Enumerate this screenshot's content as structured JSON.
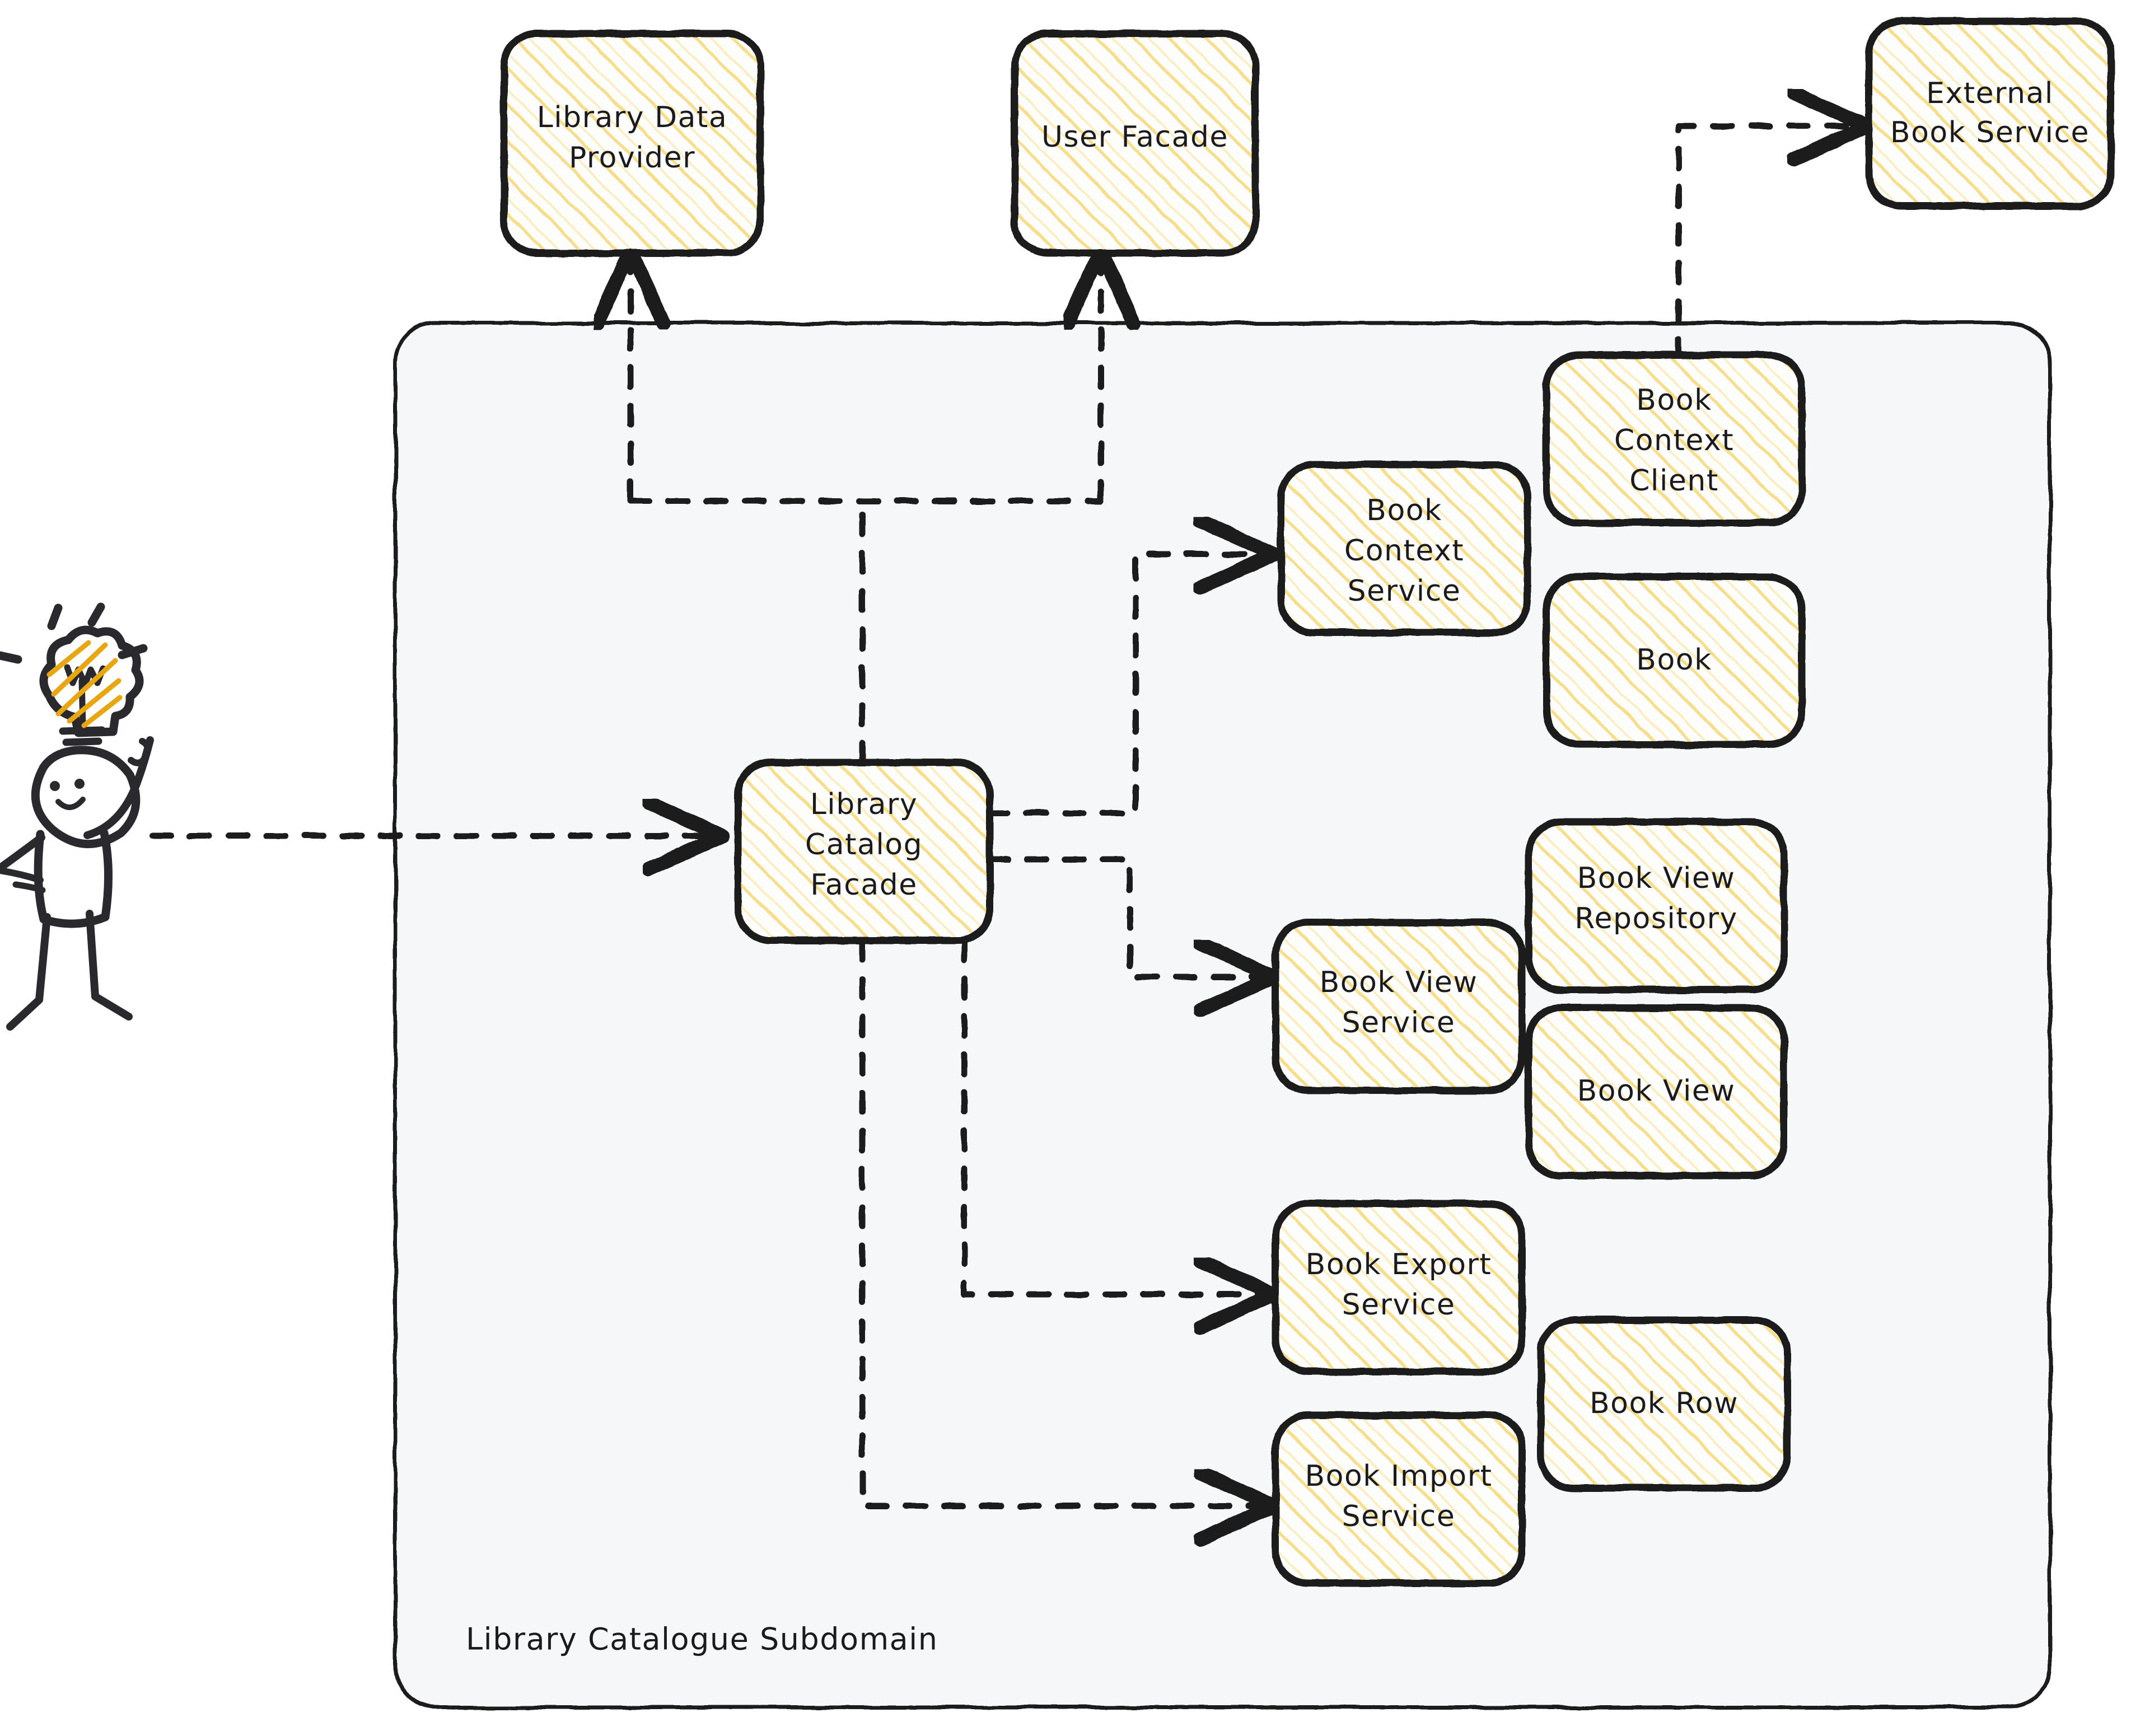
{
  "diagram": {
    "type": "architecture-component-diagram",
    "style": "hand-drawn sketch",
    "colors": {
      "node_stroke": "#1b1b1f",
      "node_hatch": "#f6de8d",
      "node_fill": "#fdfdfb",
      "group_fill": "#f5f7f9",
      "group_stroke": "#1b1b1f",
      "connector": "#1b1b1f",
      "bulb_accent": "#e8a712"
    },
    "group": {
      "label": "Library Catalogue Subdomain",
      "name": "library-catalogue-subdomain"
    },
    "actor": {
      "name": "user-stick-figure",
      "has_idea_bulb": true,
      "label": ""
    },
    "external_nodes": [
      {
        "id": "library-data-provider",
        "label": "Library Data\nProvider",
        "lines": [
          "Library Data",
          "Provider"
        ]
      },
      {
        "id": "user-facade",
        "label": "User Facade",
        "lines": [
          "User Facade"
        ]
      },
      {
        "id": "external-book-service",
        "label": "External\nBook Service",
        "lines": [
          "External",
          "Book Service"
        ]
      }
    ],
    "internal_nodes": [
      {
        "id": "library-catalog-facade",
        "label": "Library Catalog Facade",
        "lines": [
          "Library",
          "Catalog",
          "Facade"
        ]
      },
      {
        "id": "book-context-service",
        "label": "Book Context Service",
        "lines": [
          "Book",
          "Context",
          "Service"
        ]
      },
      {
        "id": "book-context-client",
        "label": "Book Context Client",
        "lines": [
          "Book",
          "Context",
          "Client"
        ]
      },
      {
        "id": "book",
        "label": "Book",
        "lines": [
          "Book"
        ]
      },
      {
        "id": "book-view-service",
        "label": "Book View Service",
        "lines": [
          "Book View",
          "Service"
        ]
      },
      {
        "id": "book-view-repository",
        "label": "Book View Repository",
        "lines": [
          "Book View",
          "Repository"
        ]
      },
      {
        "id": "book-view",
        "label": "Book View",
        "lines": [
          "Book View"
        ]
      },
      {
        "id": "book-export-service",
        "label": "Book Export Service",
        "lines": [
          "Book Export",
          "Service"
        ]
      },
      {
        "id": "book-import-service",
        "label": "Book Import Service",
        "lines": [
          "Book Import",
          "Service"
        ]
      },
      {
        "id": "book-row",
        "label": "Book Row",
        "lines": [
          "Book Row"
        ]
      }
    ],
    "edges": [
      {
        "from": "user-stick-figure",
        "to": "library-catalog-facade",
        "style": "dashed",
        "arrow": "end"
      },
      {
        "from": "library-catalog-facade",
        "to": "library-data-provider",
        "style": "dashed",
        "arrow": "end"
      },
      {
        "from": "library-catalog-facade",
        "to": "user-facade",
        "style": "dashed",
        "arrow": "end"
      },
      {
        "from": "library-catalog-facade",
        "to": "book-context-service",
        "style": "dashed",
        "arrow": "end"
      },
      {
        "from": "library-catalog-facade",
        "to": "book-view-service",
        "style": "dashed",
        "arrow": "end"
      },
      {
        "from": "library-catalog-facade",
        "to": "book-export-service",
        "style": "dashed",
        "arrow": "end"
      },
      {
        "from": "library-catalog-facade",
        "to": "book-import-service",
        "style": "dashed",
        "arrow": "end"
      },
      {
        "from": "book-context-client",
        "to": "external-book-service",
        "style": "dashed",
        "arrow": "end"
      }
    ]
  }
}
